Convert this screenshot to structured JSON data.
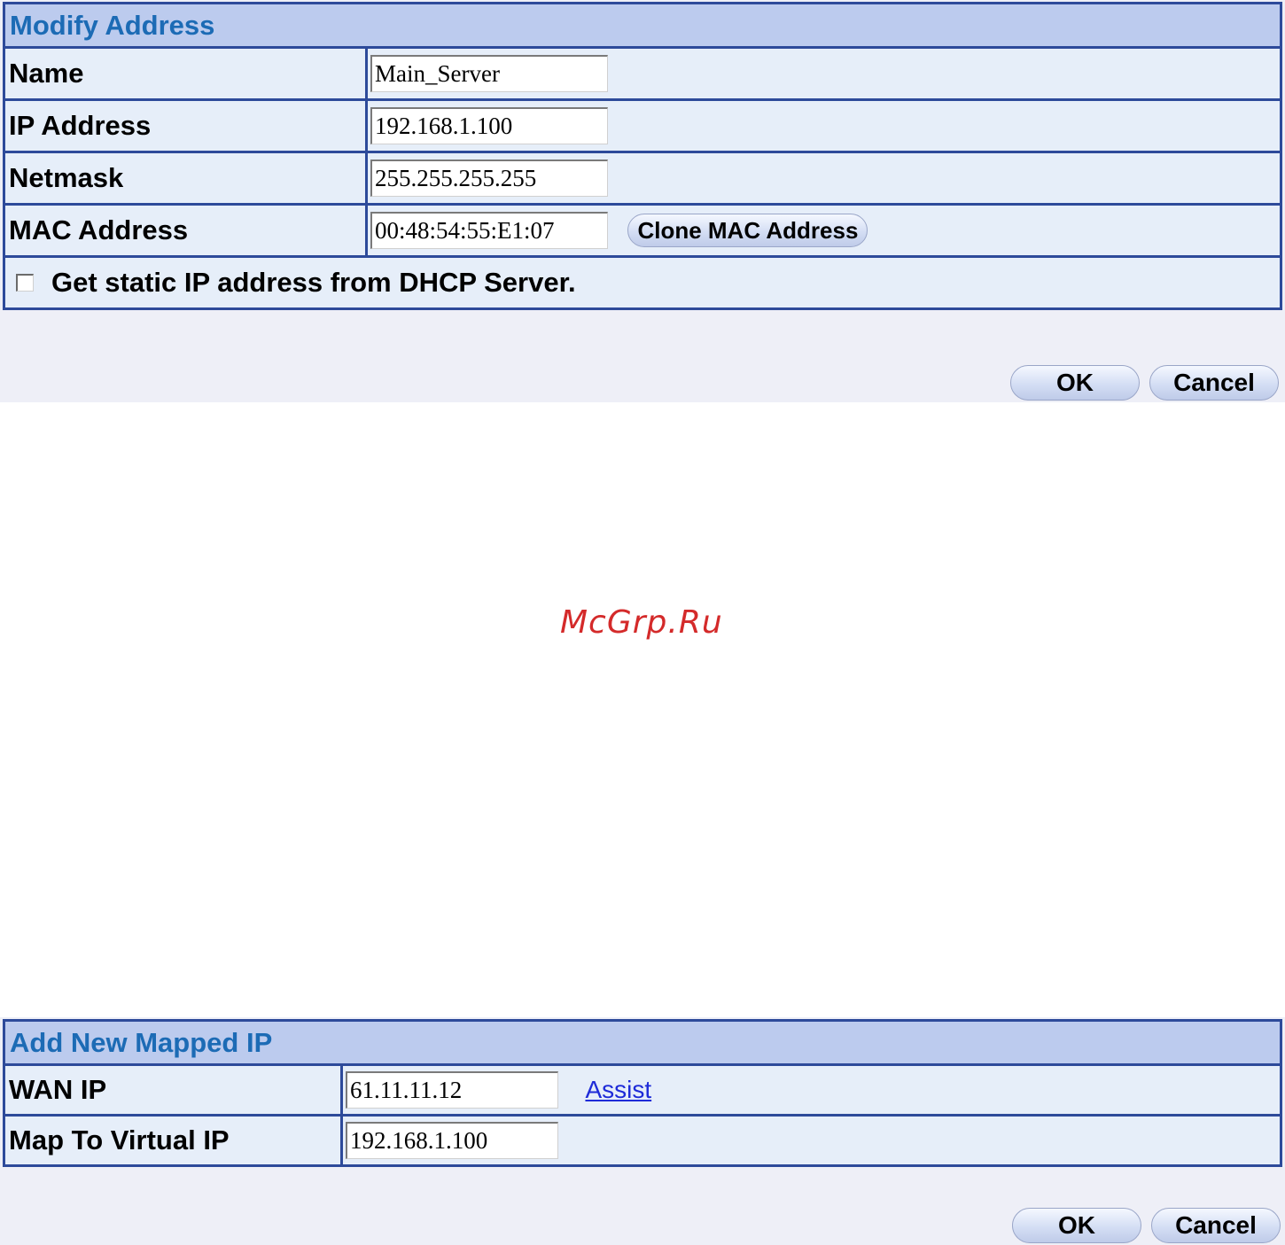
{
  "modify_address": {
    "title": "Modify Address",
    "rows": [
      {
        "label": "Name",
        "value": "Main_Server"
      },
      {
        "label": "IP Address",
        "value": "192.168.1.100"
      },
      {
        "label": "Netmask",
        "value": "255.255.255.255"
      },
      {
        "label": "MAC Address",
        "value": "00:48:54:55:E1:07"
      }
    ],
    "clone_mac_label": "Clone MAC Address",
    "dhcp_checkbox_label": "Get static IP address from DHCP Server.",
    "dhcp_checked": false,
    "ok_label": "OK",
    "cancel_label": "Cancel"
  },
  "watermark": "McGrp.Ru",
  "add_mapped_ip": {
    "title": "Add New Mapped IP",
    "rows": [
      {
        "label": "WAN IP",
        "value": "61.11.11.12"
      },
      {
        "label": "Map To Virtual IP",
        "value": "192.168.1.100"
      }
    ],
    "assist_label": "Assist",
    "ok_label": "OK",
    "cancel_label": "Cancel"
  },
  "colors": {
    "border": "#2d4a9a",
    "header_bg": "#bccbee",
    "header_text": "#1c6bb5",
    "row_bg": "#e6eef9",
    "panel_bg": "#eeeff7",
    "link": "#1e2bd8",
    "watermark": "#d42a2a"
  }
}
